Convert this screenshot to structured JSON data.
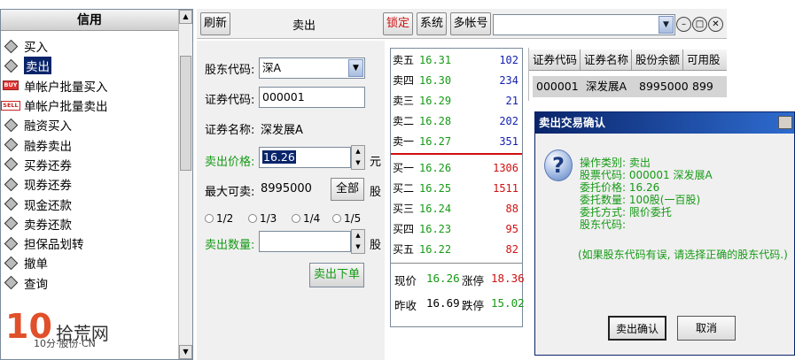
{
  "left_menu": {
    "title": "信用",
    "items": [
      {
        "label": "买入",
        "icon": "diamond-icon"
      },
      {
        "label": "卖出",
        "icon": "diamond-icon",
        "selected": true
      },
      {
        "label": "单帐户批量买入",
        "icon": "buy-badge-icon"
      },
      {
        "label": "单帐户批量卖出",
        "icon": "sell-badge-icon"
      },
      {
        "label": "融资买入",
        "icon": "diamond-icon"
      },
      {
        "label": "融券卖出",
        "icon": "diamond-icon"
      },
      {
        "label": "买券还券",
        "icon": "diamond-icon"
      },
      {
        "label": "现券还券",
        "icon": "diamond-icon"
      },
      {
        "label": "现金还款",
        "icon": "diamond-icon"
      },
      {
        "label": "卖券还款",
        "icon": "diamond-icon"
      },
      {
        "label": "担保品划转",
        "icon": "diamond-icon"
      },
      {
        "label": "撤单",
        "icon": "diamond-icon"
      },
      {
        "label": "查询",
        "icon": "diamond-icon"
      }
    ],
    "badges": {
      "buy": "BUY",
      "sell": "SELL"
    }
  },
  "toolbar": {
    "refresh": "刷新",
    "title": "卖出",
    "lock": "锁定",
    "system": "系统",
    "multi_account": "多帐号"
  },
  "form": {
    "holder_code_label": "股东代码:",
    "holder_code_value": "深A",
    "stock_code_label": "证券代码:",
    "stock_code_value": "000001",
    "stock_name_label": "证券名称:",
    "stock_name_value": "深发展A",
    "price_label": "卖出价格:",
    "price_value": "16.26",
    "price_unit": "元",
    "max_label": "最大可卖:",
    "max_value": "8995000",
    "all_button": "全部",
    "max_unit": "股",
    "ratios": [
      "1/2",
      "1/3",
      "1/4",
      "1/5"
    ],
    "qty_label": "卖出数量:",
    "qty_value": "",
    "qty_unit": "股",
    "submit": "卖出下单"
  },
  "quote": {
    "asks": [
      {
        "label": "卖五",
        "price": "16.31",
        "vol": "102"
      },
      {
        "label": "卖四",
        "price": "16.30",
        "vol": "234"
      },
      {
        "label": "卖三",
        "price": "16.29",
        "vol": "21"
      },
      {
        "label": "卖二",
        "price": "16.28",
        "vol": "202"
      },
      {
        "label": "卖一",
        "price": "16.27",
        "vol": "351"
      }
    ],
    "bids": [
      {
        "label": "买一",
        "price": "16.26",
        "vol": "1306"
      },
      {
        "label": "买二",
        "price": "16.25",
        "vol": "1511"
      },
      {
        "label": "买三",
        "price": "16.24",
        "vol": "88"
      },
      {
        "label": "买四",
        "price": "16.23",
        "vol": "95"
      },
      {
        "label": "买五",
        "price": "16.22",
        "vol": "82"
      }
    ],
    "now_label": "现价",
    "now_value": "16.26",
    "limit_up_label": "涨停",
    "limit_up_value": "18.36",
    "prev_label": "昨收",
    "prev_value": "16.69",
    "limit_down_label": "跌停",
    "limit_down_value": "15.02"
  },
  "holdings": {
    "columns": [
      "证券代码",
      "证券名称",
      "股份余额",
      "可用股"
    ],
    "rows": [
      [
        "000001",
        "深发展A",
        "8995000",
        "899"
      ]
    ]
  },
  "dialog": {
    "title": "卖出交易确认",
    "lines": [
      "操作类别: 卖出",
      "股票代码: 000001  深发展A",
      "委托价格: 16.26",
      "委托数量: 100股(一百股)",
      "委托方式: 限价委托",
      "股东代码:"
    ],
    "warning": "(如果股东代码有误, 请选择正确的股东代码.)",
    "confirm": "卖出确认",
    "cancel": "取消"
  },
  "watermark": {
    "number": "10",
    "text": "拾荒网",
    "sub": "10分·股份·CN"
  },
  "colors": {
    "accent_red": "#d01010",
    "accent_green": "#159a15",
    "selection": "#0a246a",
    "bid_volume": "#d01010",
    "ask_volume": "#1520b0"
  }
}
